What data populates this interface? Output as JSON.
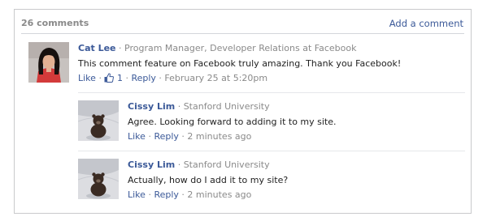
{
  "header": {
    "count": "26 comments",
    "add_comment": "Add a comment"
  },
  "comments": [
    {
      "name": "Cat Lee",
      "separator": "·",
      "affiliation": "Program Manager, Developer Relations at Facebook",
      "text": "This comment feature on Facebook truly amazing. Thank you Facebook!",
      "like": "Like",
      "like_count": "1",
      "reply": "Reply",
      "timestamp": "February 25 at 5:20pm"
    },
    {
      "name": "Cissy Lim",
      "separator": "·",
      "affiliation": "Stanford University",
      "text": "Agree. Looking forward to adding it to my site.",
      "like": "Like",
      "reply": "Reply",
      "timestamp": "2 minutes ago"
    },
    {
      "name": "Cissy Lim",
      "separator": "·",
      "affiliation": "Stanford University",
      "text": "Actually, how do I add it to my site?",
      "like": "Like",
      "reply": "Reply",
      "timestamp": "2 minutes ago"
    }
  ],
  "colors": {
    "link": "#3b5998",
    "muted": "#8a8a8a",
    "border": "#c9cacc"
  },
  "icons": {
    "like_count": "thumbs-up-icon"
  }
}
